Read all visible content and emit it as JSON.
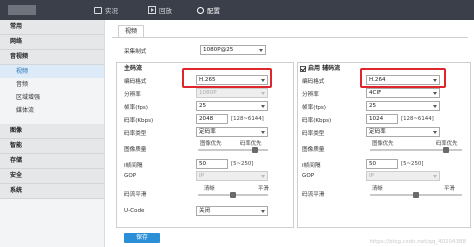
{
  "nav": {
    "items": [
      {
        "label": "实况",
        "icon": "tv-icon"
      },
      {
        "label": "回放",
        "icon": "play-icon"
      },
      {
        "label": "配置",
        "icon": "gear-icon"
      }
    ],
    "active": "配置"
  },
  "sidebar": {
    "common": "常用",
    "network": "网络",
    "av": "音视频",
    "av_items": [
      "视频",
      "音频",
      "区域增强",
      "媒体流"
    ],
    "rest": [
      "图像",
      "智能",
      "存储",
      "安全",
      "系统"
    ]
  },
  "tab": "视频",
  "capture": {
    "label": "采集制式",
    "value": "1080P@25"
  },
  "main_stream": {
    "title": "主码流",
    "codec": {
      "label": "编码格式",
      "value": "H.265"
    },
    "resolution": {
      "label": "分辨率",
      "value": "1080P"
    },
    "fps": {
      "label": "帧率(fps)",
      "value": "25"
    },
    "bitrate": {
      "label": "码率(Kbps)",
      "value": "2048",
      "range": "[128~6144]"
    },
    "bitrate_type": {
      "label": "码率类型",
      "value": "定码率"
    },
    "quality": {
      "label": "图像质量",
      "left": "图像优先",
      "right": "码率优先",
      "level": 0.85
    },
    "iframe": {
      "label": "I帧间隔",
      "value": "50",
      "range": "[5~250]"
    },
    "gop": {
      "label": "GOP",
      "value": "IP"
    },
    "smooth": {
      "label": "码流平滑",
      "left": "清晰",
      "right": "平滑",
      "level": 0.5
    },
    "ucode": {
      "label": "U-Code",
      "value": "关闭"
    }
  },
  "sub_stream": {
    "title": "启用  辅码流",
    "codec": {
      "label": "编码格式",
      "value": "H.264"
    },
    "resolution": {
      "label": "分辨率",
      "value": "4CIF"
    },
    "fps": {
      "label": "帧率(fps)",
      "value": "25"
    },
    "bitrate": {
      "label": "码率(Kbps)",
      "value": "1024",
      "range": "[128~6144]"
    },
    "bitrate_type": {
      "label": "码率类型",
      "value": "定码率"
    },
    "quality": {
      "label": "图像质量",
      "left": "图像优先",
      "right": "码率优先",
      "level": 0.85
    },
    "iframe": {
      "label": "I帧间隔",
      "value": "50",
      "range": "[5~250]"
    },
    "gop": {
      "label": "GOP",
      "value": "IP"
    },
    "smooth": {
      "label": "码流平滑",
      "left": "清晰",
      "right": "平滑",
      "level": 0.5
    }
  },
  "save": "保存",
  "watermark": "https://blog.csdn.net/qq_40204388",
  "colors": {
    "accent": "#2b8fd8",
    "highlight": "#e0262d",
    "topbar": "#3a3f49"
  }
}
